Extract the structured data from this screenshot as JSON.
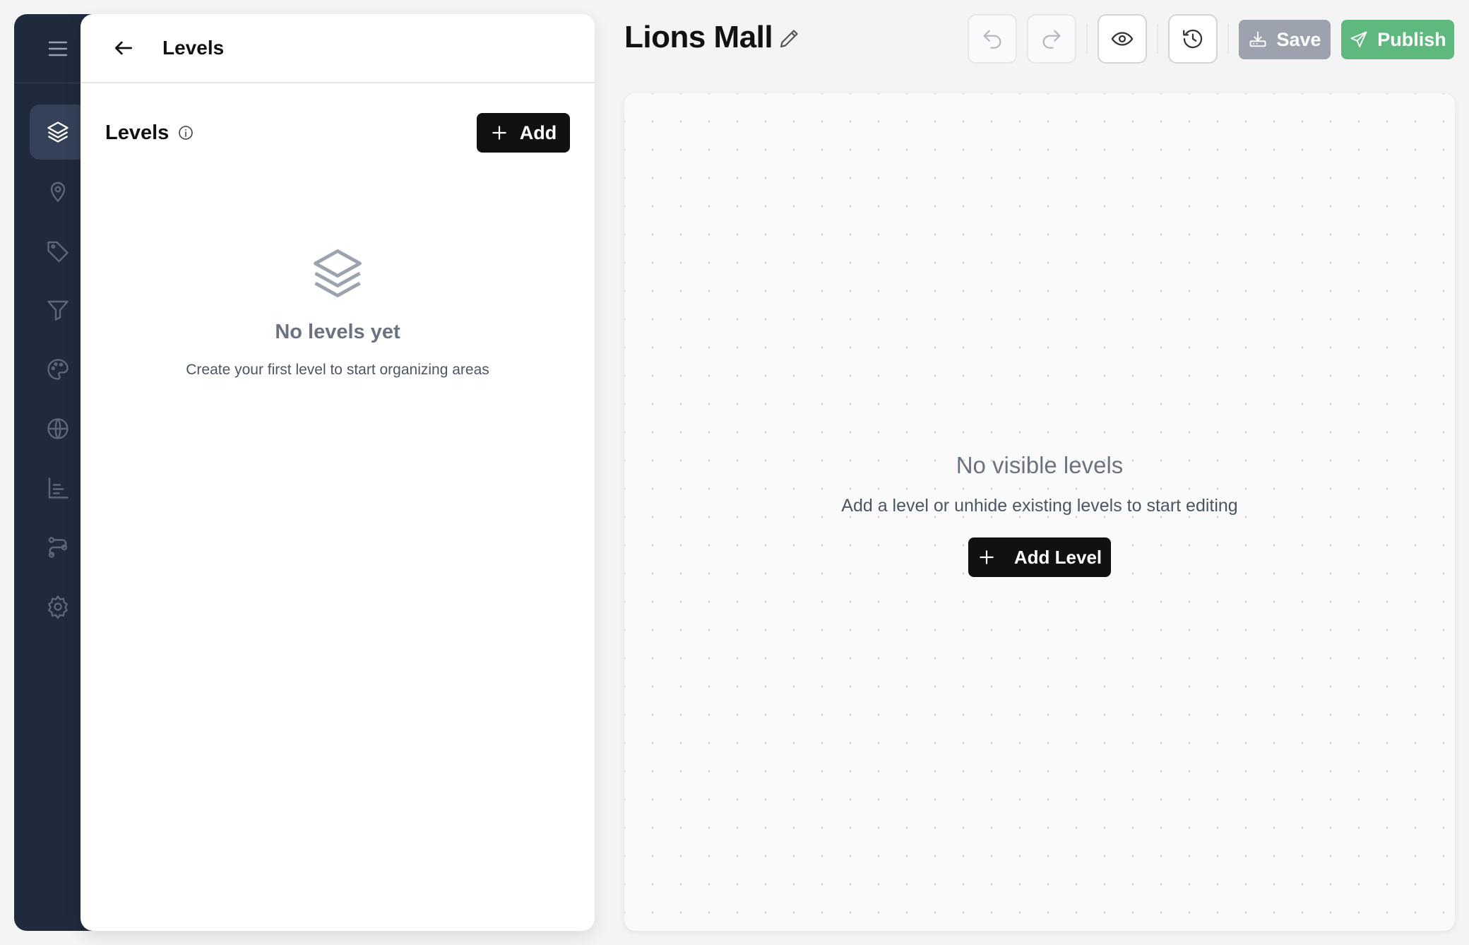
{
  "rail": {
    "items": [
      {
        "name": "menu-icon"
      },
      {
        "name": "layers-icon",
        "active": true
      },
      {
        "name": "map-pin-icon"
      },
      {
        "name": "tag-icon"
      },
      {
        "name": "filter-icon"
      },
      {
        "name": "palette-icon"
      },
      {
        "name": "globe-icon"
      },
      {
        "name": "chart-icon"
      },
      {
        "name": "route-icon"
      },
      {
        "name": "gear-icon"
      }
    ]
  },
  "panel": {
    "title": "Levels",
    "section_label": "Levels",
    "add_label": "Add",
    "empty_title": "No levels yet",
    "empty_desc": "Create your first level to start organizing areas"
  },
  "header": {
    "title": "Lions Mall",
    "save_label": "Save",
    "publish_label": "Publish"
  },
  "canvas": {
    "empty_title": "No visible levels",
    "empty_desc": "Add a level or unhide existing levels to start editing",
    "add_level_label": "Add Level"
  },
  "colors": {
    "rail_bg": "#1f2a3d",
    "publish": "#5fb97f",
    "save_disabled": "#9ca3af",
    "primary": "#111111"
  }
}
